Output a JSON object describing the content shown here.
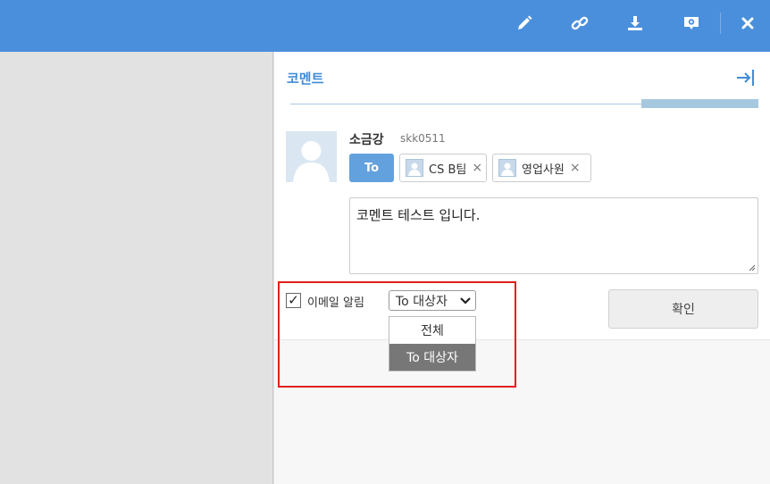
{
  "toolbar": {
    "icons": [
      "pencil-icon",
      "link-icon",
      "download-icon",
      "settings-icon",
      "close-icon"
    ],
    "color": "#4a8fdc"
  },
  "comment_panel": {
    "title": "코멘트",
    "author": {
      "name": "소금강",
      "id": "skk0511"
    },
    "to_label": "To",
    "recipients": [
      {
        "name": "CS B팀",
        "remove": "×"
      },
      {
        "name": "영업사원",
        "remove": "×"
      }
    ],
    "comment_text": "코멘트 테스트 입니다.",
    "email_notify": {
      "label": "이메일 알림",
      "checked": true,
      "check_mark": "✓"
    },
    "target_select": {
      "value": "To 대상자",
      "options": [
        "전체",
        "To 대상자"
      ],
      "selected_index": 1
    },
    "confirm_label": "확인"
  },
  "colors": {
    "accent": "#4a8fdc",
    "title": "#3f8cd8",
    "to_button": "#62a1de",
    "highlight": "#e02020"
  }
}
